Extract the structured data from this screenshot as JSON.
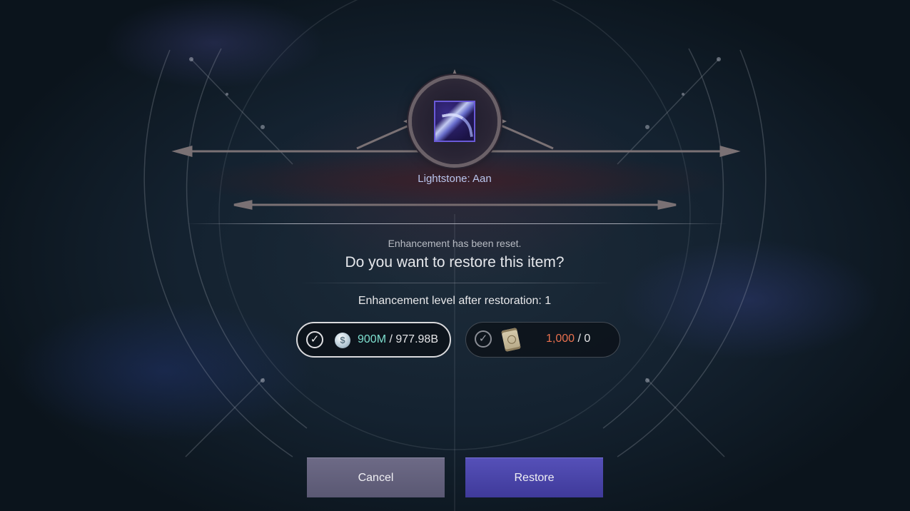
{
  "item": {
    "name": "Lightstone: Aan",
    "icon": "lightstone-icon"
  },
  "dialog": {
    "reset_message": "Enhancement has been reset.",
    "question": "Do you want to restore this item?",
    "level_text": "Enhancement level after restoration: 1"
  },
  "costs": {
    "silver": {
      "icon": "silver-coin-icon",
      "have": "900M",
      "separator": " / ",
      "need": "977.98B",
      "checked": true
    },
    "scroll": {
      "icon": "scroll-icon",
      "have": "1,000",
      "separator": " / ",
      "need": "0",
      "checked": true
    }
  },
  "buttons": {
    "cancel": "Cancel",
    "restore": "Restore"
  },
  "colors": {
    "have_silver": "#7ee0d0",
    "have_scroll": "#e8704e",
    "restore_button": "#4a45aa",
    "cancel_button": "#64627e"
  }
}
